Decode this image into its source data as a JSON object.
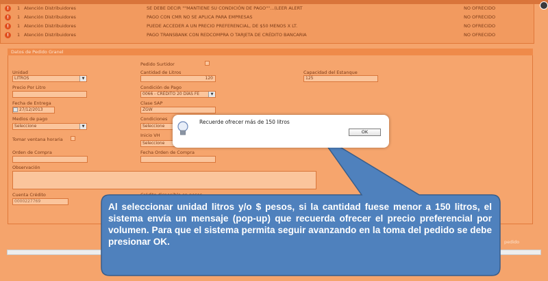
{
  "alerts": [
    {
      "num": "1",
      "type": "Atención Distribuidores",
      "message": "SE DEBE DECIR \"\"MANTIENE SU CONDICIÓN DE PAGO\"\"...(LEER ALERT",
      "status": "NO OFRECIDO"
    },
    {
      "num": "1",
      "type": "Atención Distribuidores",
      "message": "PAGO CON CMR NO SE APLICA PARA EMPRESAS",
      "status": "NO OFRECIDO"
    },
    {
      "num": "1",
      "type": "Atención Distribuidores",
      "message": "PUEDE ACCEDER A UN PRECIO PREFERENCIAL, DE $50 MENOS X LT.",
      "status": "NO OFRECIDO"
    },
    {
      "num": "1",
      "type": "Atención Distribuidores",
      "message": "PAGO TRANSBANK CON REDCOMPRA O TARJETA DE CRÉDITO BANCARIA",
      "status": "NO OFRECIDO"
    }
  ],
  "panel": {
    "title": "Datos de Pedido Granel",
    "pedido_surtidor_label": "Pedido Surtidor",
    "unidad_label": "Unidad",
    "unidad_value": "LITROS",
    "cantidad_label": "Cantidad de Litros",
    "cantidad_value": "120",
    "capacidad_label": "Capacidad del Estanque",
    "capacidad_value": "125",
    "precio_label": "Precio Por Litro",
    "precio_value": "",
    "condicion_pago_label": "Condición de Pago",
    "condicion_pago_value": "0066 - CRÉDITO 20 DÍAS FE",
    "fecha_entrega_label": "Fecha de Entrega",
    "fecha_entrega_value": "27/12/2013",
    "clase_sap_label": "Clase SAP",
    "clase_sap_value": "ZGW",
    "medios_pago_label": "Medios de pago",
    "medios_pago_value": "Seleccione",
    "condiciones_label": "Condiciones",
    "condiciones_value": "Seleccione",
    "tomar_ventana_label": "Tomar ventana horaria",
    "inicio_vh_label": "Inicio VH",
    "inicio_vh_value": "Seleccione",
    "orden_compra_label": "Orden de Compra",
    "orden_compra_value": "",
    "fecha_orden_label": "Fecha Orden de Compra",
    "fecha_orden_value": "",
    "observacion_label": "Observación",
    "observacion_value": "",
    "cuenta_credito_label": "Cuenta Crédito",
    "cuenta_credito_value": "0000227769",
    "credito_disponible_label": "Crédito disponible en pesos"
  },
  "footer": {
    "pedido_label": "pedido"
  },
  "dialog": {
    "message": "Recuerde ofrecer más de 150 litros",
    "ok_label": "OK",
    "icon": "lightbulb-icon"
  },
  "callout": {
    "text": "Al seleccionar unidad litros y/o $ pesos, si la cantidad fuese menor a 150 litros, el sistema envía un mensaje (pop-up) que recuerda ofrecer el precio preferencial por volumen. Para que el sistema permita seguir avanzando en la toma del pedido se debe presionar OK.",
    "fill_color": "#4f81bd",
    "stroke_color": "#385d8a"
  }
}
